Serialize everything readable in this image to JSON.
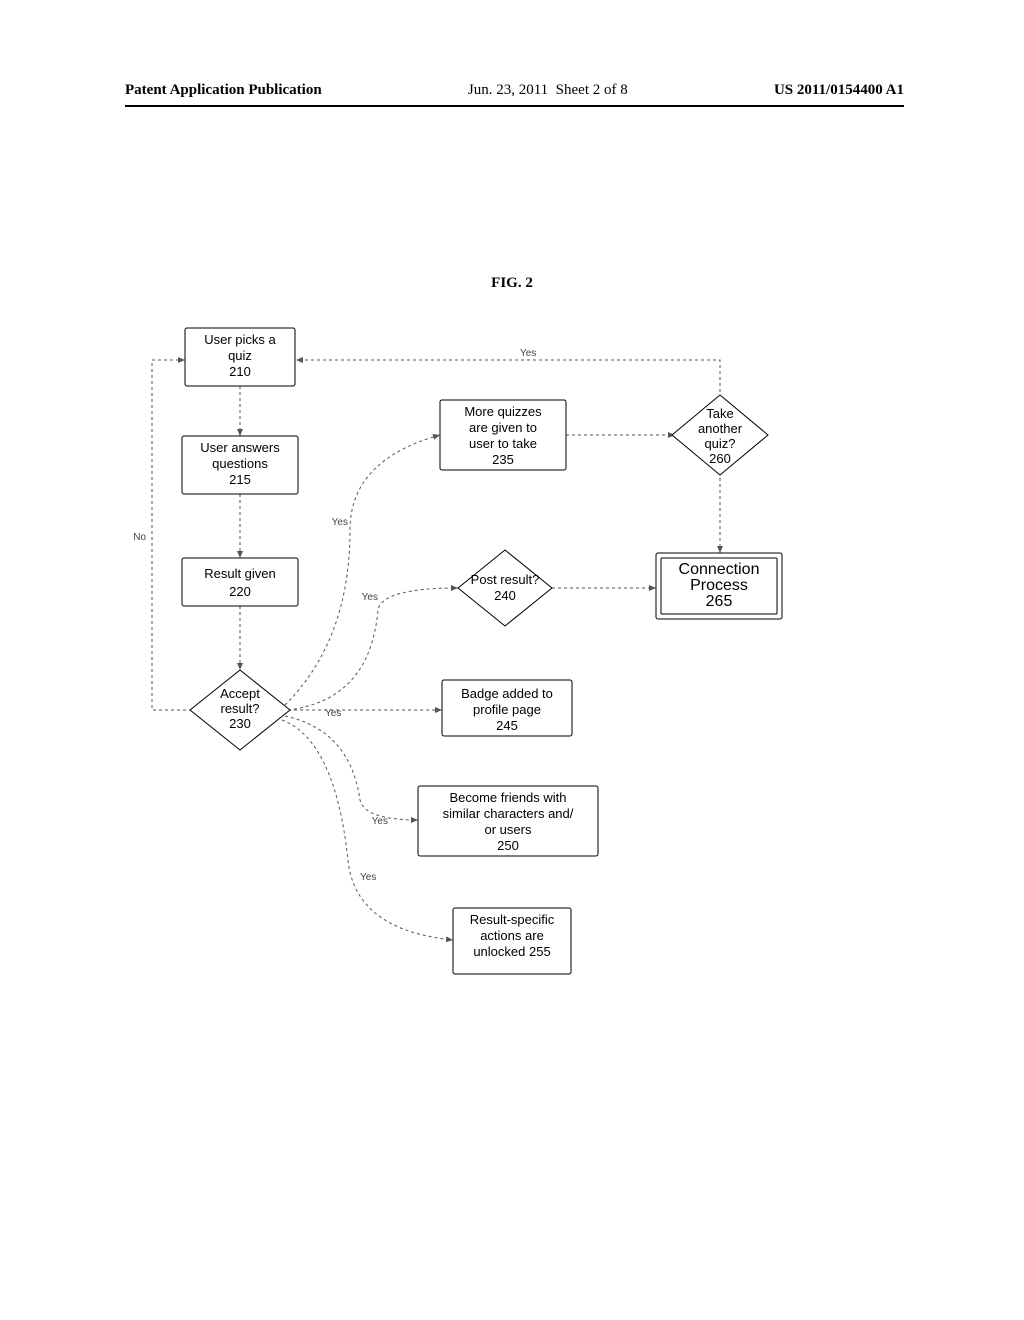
{
  "header": {
    "left": "Patent Application Publication",
    "mid_date": "Jun. 23, 2011",
    "mid_sheet": "Sheet 2 of 8",
    "right": "US 2011/0154400 A1"
  },
  "figure_title": "FIG. 2",
  "nodes": {
    "n210": {
      "l1": "User picks a",
      "l2": "quiz",
      "ref": "210"
    },
    "n215": {
      "l1": "User answers",
      "l2": "questions",
      "ref": "215"
    },
    "n220": {
      "l1": "Result given",
      "ref": "220"
    },
    "n230": {
      "l1": "Accept",
      "l2": "result?",
      "ref": "230"
    },
    "n235": {
      "l1": "More quizzes",
      "l2": "are given to",
      "l3": "user to take",
      "ref": "235"
    },
    "n240": {
      "l1": "Post result?",
      "ref": "240"
    },
    "n245": {
      "l1": "Badge added to",
      "l2": "profile page",
      "ref": "245"
    },
    "n250": {
      "l1": "Become friends with",
      "l2": "similar characters and/",
      "l3": "or users",
      "ref": "250"
    },
    "n255": {
      "l1": "Result-specific",
      "l2": "actions are",
      "l3": "unlocked",
      "ref": "255"
    },
    "n260": {
      "l1": "Take",
      "l2": "another",
      "l3": "quiz?",
      "ref": "260"
    },
    "n265": {
      "l1": "Connection",
      "l2": "Process",
      "ref": "265"
    }
  },
  "edge_labels": {
    "yes": "Yes",
    "no": "No"
  }
}
